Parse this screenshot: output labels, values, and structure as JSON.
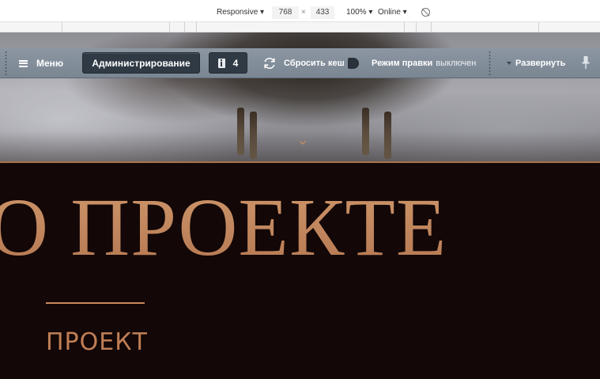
{
  "devtools": {
    "device": "Responsive",
    "width": "768",
    "times": "×",
    "height": "433",
    "zoom": "100%",
    "throttle": "Online"
  },
  "admin_panel": {
    "menu_label": "Меню",
    "admin_button": "Администрирование",
    "notifications_count": "4",
    "clear_cache": "Сбросить кеш",
    "edit_mode_label": "Режим правки",
    "edit_mode_state": "выключен",
    "expand_label": "Развернуть",
    "bg_color": "#7b8693",
    "button_color": "#2f3a45"
  },
  "page": {
    "title": "О ПРОЕКТЕ",
    "section_label": "ПРОЕКТ",
    "accent_color": "#c2865c",
    "background_color": "#130707"
  }
}
